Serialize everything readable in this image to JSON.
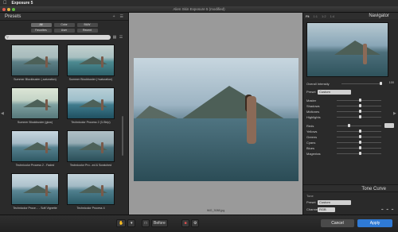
{
  "menubar": {
    "app_name": "Exposure 5"
  },
  "window": {
    "title": "Alien Skin Exposure 5 (modified)"
  },
  "left_panel": {
    "title": "Presets",
    "filters": [
      "All",
      "Color",
      "B&W",
      "Favorites",
      "User",
      "Recent"
    ],
    "search_placeholder": "",
    "presets": [
      {
        "label": "Summer Blockbuster (-saturation)"
      },
      {
        "label": "Summer Blockbuster (+saturation)"
      },
      {
        "label": "Summer Blockbuster (glow)"
      },
      {
        "label": "Technicolor Process 2 (3-Strip)"
      },
      {
        "label": "Technicolor Process 2 - Faded"
      },
      {
        "label": "Technicolor Pro...ed & Scratched"
      },
      {
        "label": "Technicolor Proce... - Soft Vignette"
      },
      {
        "label": "Technicolor Process 4"
      }
    ]
  },
  "center": {
    "filename": "IMG_3088.jpg"
  },
  "right_panel": {
    "tabs": [
      "Fit",
      "1:1",
      "1:2",
      "1:4"
    ],
    "navigator_title": "Navigator",
    "overall_intensity_label": "Overall Intensity",
    "overall_intensity_value": "100",
    "preset_label": "Preset",
    "preset_value": "Custom",
    "sliders": [
      {
        "label": "Master"
      },
      {
        "label": "Shadows"
      },
      {
        "label": "Midtones"
      },
      {
        "label": "Highlights"
      },
      {
        "label": "Reds"
      },
      {
        "label": "Yellows"
      },
      {
        "label": "Greens"
      },
      {
        "label": "Cyans"
      },
      {
        "label": "Blues"
      },
      {
        "label": "Magentas"
      }
    ],
    "tone_curve_title": "Tone Curve",
    "tone_label": "Tone",
    "tone_preset_label": "Preset",
    "tone_preset_value": "Custom",
    "channel_label": "Channel",
    "channel_value": "RGB"
  },
  "toolbar": {
    "before_label": "Before",
    "cancel_label": "Cancel",
    "apply_label": "Apply"
  }
}
